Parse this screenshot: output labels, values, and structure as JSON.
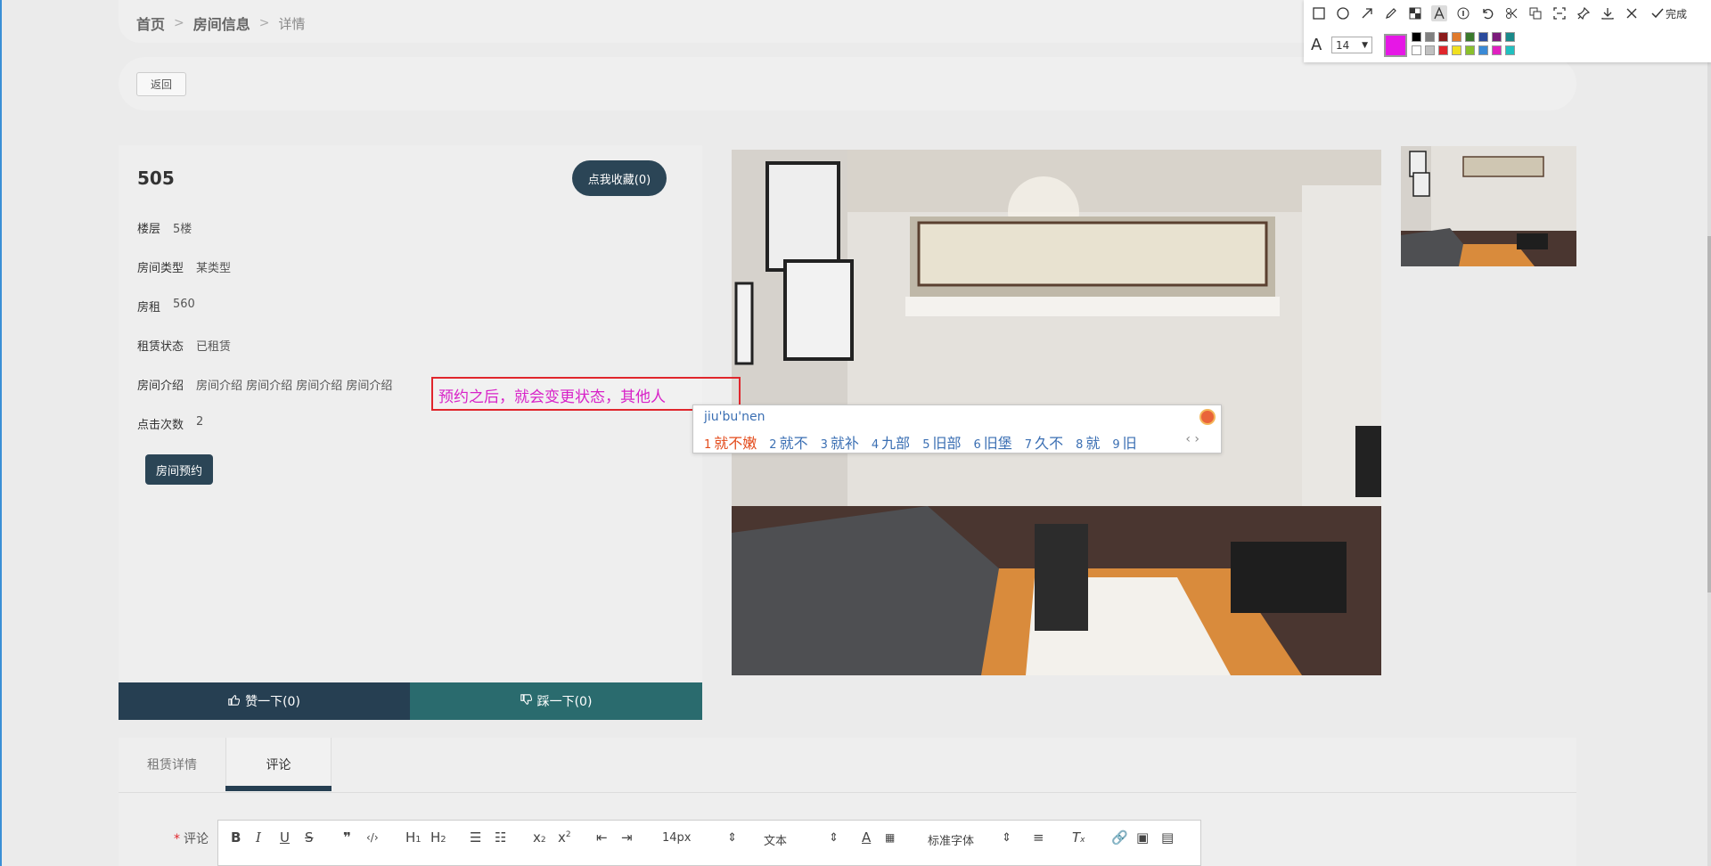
{
  "breadcrumb": {
    "home": "首页",
    "section": "房间信息",
    "current": "详情",
    "sep": ">"
  },
  "back_label": "返回",
  "room": {
    "number": "505",
    "favorite_label": "点我收藏(0)",
    "fields": [
      {
        "label": "楼层",
        "value": "5楼"
      },
      {
        "label": "房间类型",
        "value": "某类型"
      },
      {
        "label": "房租",
        "value": "560"
      },
      {
        "label": "租赁状态",
        "value": "已租赁"
      },
      {
        "label": "房间介绍",
        "value": "房间介绍 房间介绍 房间介绍 房间介绍"
      },
      {
        "label": "点击次数",
        "value": "2"
      }
    ],
    "book_label": "房间预约",
    "like_label": "赞一下(0)",
    "dislike_label": "踩一下(0)"
  },
  "annotation": {
    "text": "预约之后，就会变更状态，其他人"
  },
  "ime": {
    "input": "jiu'bu'nen",
    "candidates": [
      {
        "n": "1",
        "text": "就不嫩"
      },
      {
        "n": "2",
        "text": "就不"
      },
      {
        "n": "3",
        "text": "就补"
      },
      {
        "n": "4",
        "text": "九部"
      },
      {
        "n": "5",
        "text": "旧部"
      },
      {
        "n": "6",
        "text": "旧堡"
      },
      {
        "n": "7",
        "text": "久不"
      },
      {
        "n": "8",
        "text": "就"
      },
      {
        "n": "9",
        "text": "旧"
      }
    ]
  },
  "tabs": [
    {
      "label": "租赁详情"
    },
    {
      "label": "评论"
    }
  ],
  "comment": {
    "required_mark": "*",
    "label": "评论",
    "size_select": "14px",
    "block_select": "文本",
    "font_select": "标准字体"
  },
  "shot_tool": {
    "done_label": "完成",
    "font_size": "14",
    "current_color": "#e617e6",
    "palette": [
      "#000000",
      "#808080",
      "#8b1a1a",
      "#e07a2c",
      "#3a7a2c",
      "#2a4a9c",
      "#7a1a7a",
      "#1a8a8a",
      "#ffffff",
      "#c0c0c0",
      "#e0262c",
      "#f0e020",
      "#8ac02c",
      "#3a8ad6",
      "#e020c0",
      "#20c0c0"
    ]
  },
  "colors": {
    "dark_btn": "#2b4556",
    "teal_btn": "#2a6b6e",
    "annotation_border": "#e0262c",
    "annotation_text": "#d822c8"
  }
}
